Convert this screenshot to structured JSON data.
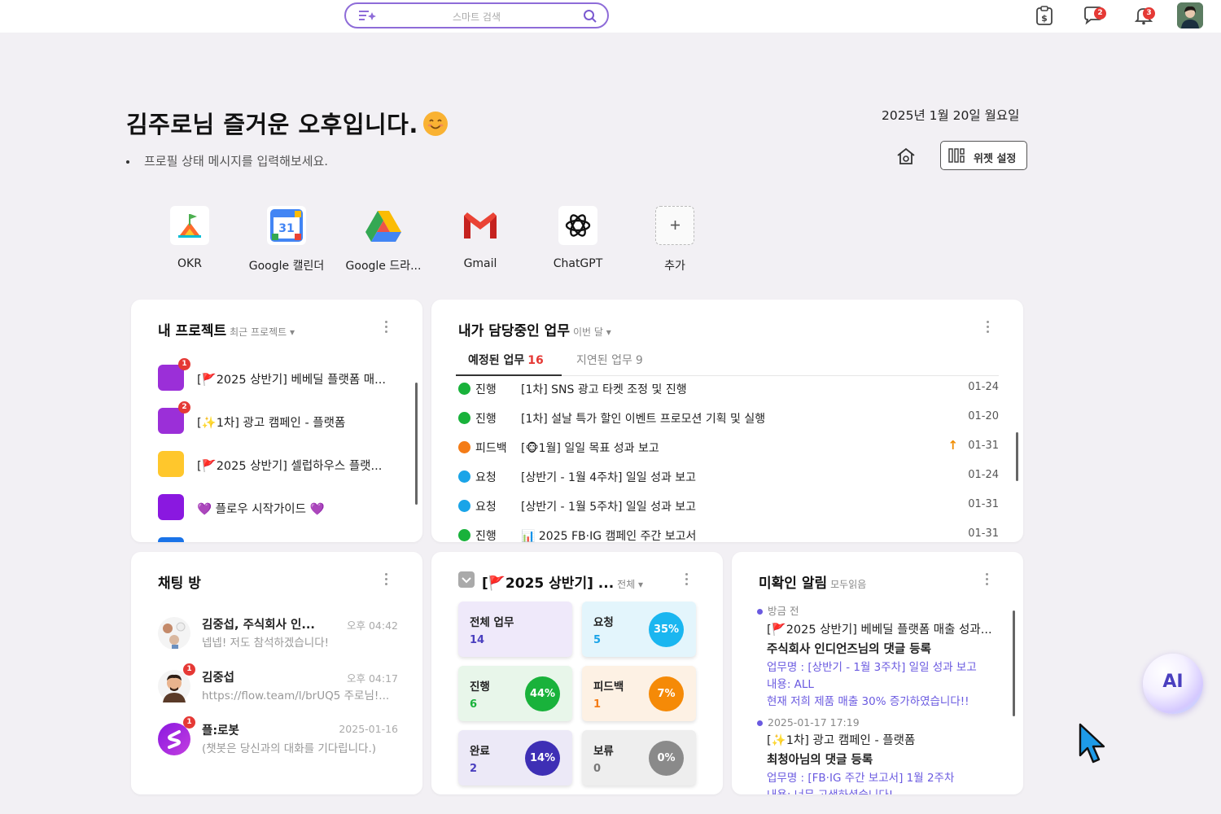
{
  "search": {
    "placeholder": "스마트 검색"
  },
  "top": {
    "chat_badge": "2",
    "bell_badge": "3"
  },
  "greeting": "김주로님 즐거운 오후입니다.",
  "status_message": "프로필 상태 메시지를 입력해보세요.",
  "date": "2025년 1월 20일 월요일",
  "widget_settings_label": "위젯 설정",
  "apps": [
    {
      "label": "OKR",
      "icon": "okr-icon"
    },
    {
      "label": "Google 캘린더",
      "icon": "google-calendar-icon"
    },
    {
      "label": "Google 드라...",
      "icon": "google-drive-icon"
    },
    {
      "label": "Gmail",
      "icon": "gmail-icon"
    },
    {
      "label": "ChatGPT",
      "icon": "chatgpt-icon"
    },
    {
      "label": "추가",
      "icon": "plus-icon"
    }
  ],
  "projects": {
    "title": "내 프로젝트",
    "filter": "최근 프로젝트 ▾",
    "items": [
      {
        "name": "[🚩2025 상반기] 베베딜 플랫폼 매...",
        "color": "#9b2fd8",
        "badge": "1"
      },
      {
        "name": "[✨1차] 광고 캠페인 - 플랫폼",
        "color": "#9b2fd8",
        "badge": "2"
      },
      {
        "name": "[🚩2025 상반기] 셀럽하우스 플랫...",
        "color": "#ffc72c",
        "badge": ""
      },
      {
        "name": "💜 플로우 시작가이드 💜",
        "color": "#8a18e0",
        "badge": ""
      }
    ]
  },
  "tasks": {
    "title": "내가 담당중인 업무",
    "filter": "이번 달 ▾",
    "tab_scheduled": "예정된 업무",
    "tab_scheduled_count": "16",
    "tab_delayed": "지연된 업무",
    "tab_delayed_count": "9",
    "items": [
      {
        "status": "진행",
        "color": "#19b23b",
        "name": "[1차] SNS 광고 타켓 조정 및 진행",
        "date": "01-24",
        "up": ""
      },
      {
        "status": "진행",
        "color": "#19b23b",
        "name": "[1차] 설날 특가 할인 이벤트 프로모션 기획 및 실행",
        "date": "01-20",
        "up": ""
      },
      {
        "status": "피드백",
        "color": "#f47c17",
        "name": "[🐵1월] 일일 목표 성과 보고",
        "date": "01-31",
        "up": "↑"
      },
      {
        "status": "요청",
        "color": "#1aa4e8",
        "name": "[상반기 - 1월 4주차] 일일 성과 보고",
        "date": "01-24",
        "up": ""
      },
      {
        "status": "요청",
        "color": "#1aa4e8",
        "name": "[상반기 - 1월 5주차] 일일 성과 보고",
        "date": "01-31",
        "up": ""
      },
      {
        "status": "진행",
        "color": "#19b23b",
        "name": "📊 2025 FB·IG 캠페인 주간 보고서",
        "date": "01-31",
        "up": ""
      }
    ]
  },
  "chats": {
    "title": "채팅 방",
    "items": [
      {
        "name": "김중섭, 주식회사 인...",
        "time": "오후 04:42",
        "msg": "넵넵! 저도 참석하겠습니다!",
        "badge": ""
      },
      {
        "name": "김중섭",
        "time": "오후 04:17",
        "msg": "https://flow.team/l/brUQ5 주로님!...",
        "badge": "1"
      },
      {
        "name": "플:로봇",
        "time": "2025-01-16",
        "msg": "(챗봇은 당신과의 대화를 기다립니다.)",
        "badge": "1"
      }
    ]
  },
  "project_stats": {
    "title": "[🚩2025 상반기] ...",
    "filter": "전체 ▾",
    "cells": [
      {
        "label": "전체 업무",
        "value": "14",
        "pct": "",
        "bg": "#efe9fa",
        "val_color": "#4a3fbf",
        "pct_color": ""
      },
      {
        "label": "요청",
        "value": "5",
        "pct": "35%",
        "bg": "#e3f5fc",
        "val_color": "#1aa4e8",
        "pct_color": "#1ab6f0"
      },
      {
        "label": "진행",
        "value": "6",
        "pct": "44%",
        "bg": "#e8f6ea",
        "val_color": "#19b23b",
        "pct_color": "#19b23b"
      },
      {
        "label": "피드백",
        "value": "1",
        "pct": "7%",
        "bg": "#fdf1e4",
        "val_color": "#f47c17",
        "pct_color": "#f58a07"
      },
      {
        "label": "완료",
        "value": "2",
        "pct": "14%",
        "bg": "#ece9f7",
        "val_color": "#4a3fbf",
        "pct_color": "#3e2fb5"
      },
      {
        "label": "보류",
        "value": "0",
        "pct": "0%",
        "bg": "#eeeeee",
        "val_color": "#777777",
        "pct_color": "#8a8a8a"
      }
    ]
  },
  "notifications": {
    "title": "미확인 알림",
    "filter": "모두읽음",
    "items": [
      {
        "time": "방금 전",
        "line1": "[🚩2025 상반기] 베베딜 플랫폼 매출 성과...",
        "line2": "주식회사 인디언즈님의 댓글 등록",
        "detail1": "업무명 : [상반기 - 1월 3주차] 일일 성과 보고",
        "detail2": "내용: ALL",
        "detail3": "현재 저희 제품 매출 30% 증가하였습니다!!"
      },
      {
        "time": "2025-01-17 17:19",
        "line1": "[✨1차] 광고 캠페인 - 플랫폼",
        "line2": "최청아님의 댓글 등록",
        "detail1": "업무명 : [FB·IG 주간 보고서] 1월 2주차",
        "detail2": "내용: 너무 고생하셨습니다!",
        "detail3": ""
      }
    ]
  },
  "ai_button_label": "AI",
  "colors": {
    "accent": "#8e6cd8",
    "badge": "#e53935",
    "background": "#f2f0f4"
  }
}
